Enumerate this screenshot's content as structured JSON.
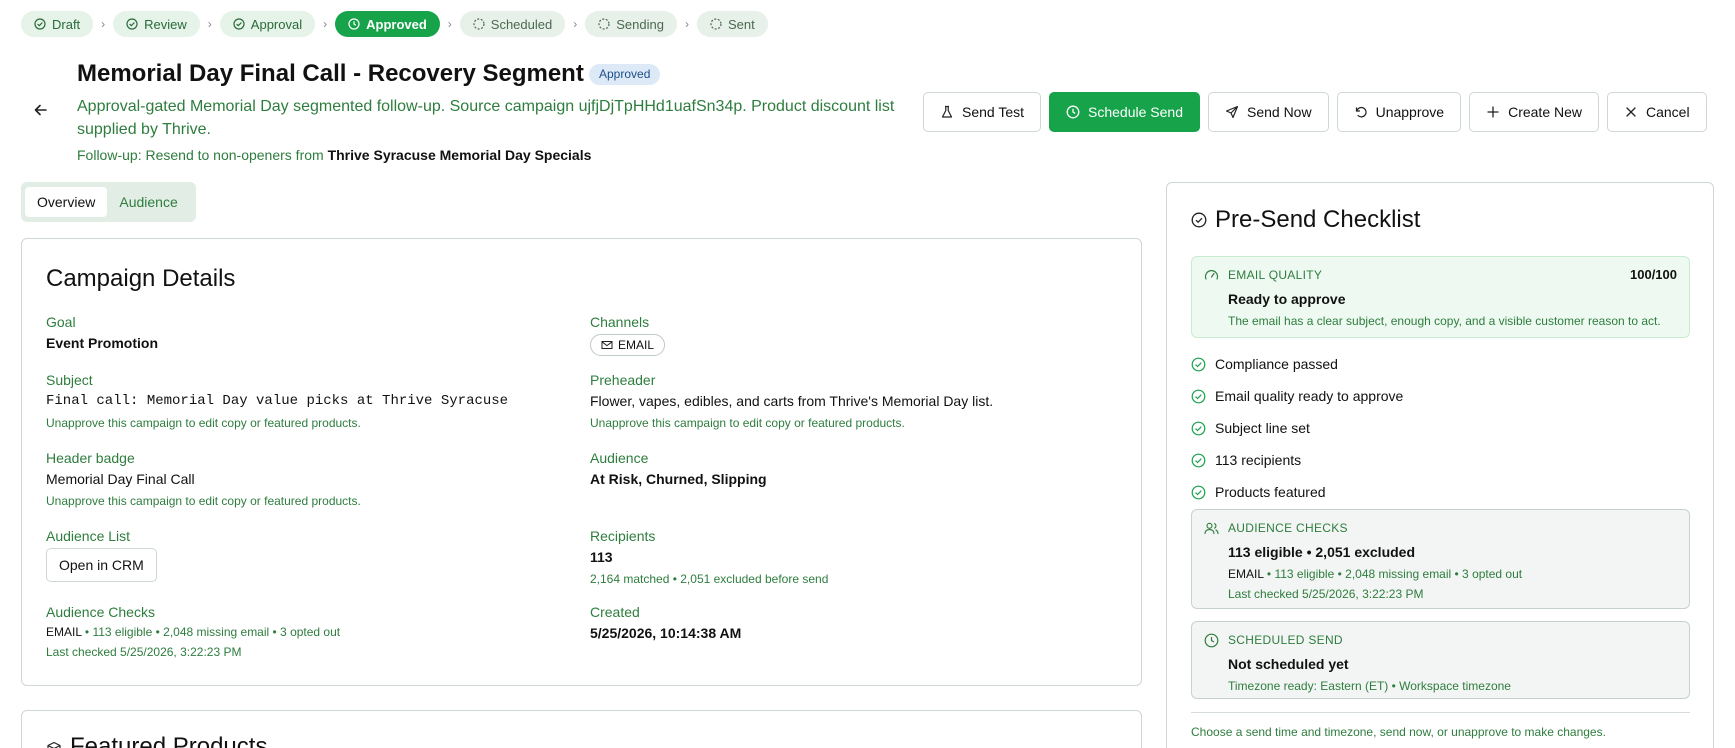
{
  "pipeline": [
    {
      "label": "Draft",
      "state": "done"
    },
    {
      "label": "Review",
      "state": "done"
    },
    {
      "label": "Approval",
      "state": "done"
    },
    {
      "label": "Approved",
      "state": "active"
    },
    {
      "label": "Scheduled",
      "state": "pending"
    },
    {
      "label": "Sending",
      "state": "pending"
    },
    {
      "label": "Sent",
      "state": "pending"
    }
  ],
  "header": {
    "title": "Memorial Day Final Call - Recovery Segment",
    "status_badge": "Approved",
    "description": "Approval-gated Memorial Day segmented follow-up. Source campaign ujfjDjTpHHd1uafSn34p. Product discount list supplied by Thrive.",
    "followup_prefix": "Follow-up: Resend to non-openers from",
    "followup_source": "Thrive Syracuse Memorial Day Specials"
  },
  "actions": {
    "send_test": "Send Test",
    "schedule_send": "Schedule Send",
    "send_now": "Send Now",
    "unapprove": "Unapprove",
    "create_new": "Create New",
    "cancel": "Cancel"
  },
  "tabs": {
    "overview": "Overview",
    "audience": "Audience"
  },
  "details": {
    "title": "Campaign Details",
    "goal_label": "Goal",
    "goal_value": "Event Promotion",
    "channels_label": "Channels",
    "channel_chip": "EMAIL",
    "subject_label": "Subject",
    "subject_value": "Final call: Memorial Day value picks at Thrive Syracuse",
    "subject_hint": "Unapprove this campaign to edit copy or featured products.",
    "preheader_label": "Preheader",
    "preheader_value": "Flower, vapes, edibles, and carts from Thrive's Memorial Day list.",
    "preheader_hint": "Unapprove this campaign to edit copy or featured products.",
    "badge_label": "Header badge",
    "badge_value": "Memorial Day Final Call",
    "badge_hint": "Unapprove this campaign to edit copy or featured products.",
    "audience_label": "Audience",
    "audience_value": "At Risk, Churned, Slipping",
    "list_label": "Audience List",
    "list_button": "Open in CRM",
    "recipients_label": "Recipients",
    "recipients_value": "113",
    "recipients_hint": "2,164 matched • 2,051 excluded before send",
    "checks_label": "Audience Checks",
    "checks_channel": "EMAIL",
    "checks_summary": " • 113 eligible • 2,048 missing email • 3 opted out",
    "checks_last": "Last checked 5/25/2026, 3:22:23 PM",
    "created_label": "Created",
    "created_value": "5/25/2026, 10:14:38 AM"
  },
  "featured": {
    "title": "Featured Products"
  },
  "checklist": {
    "title": "Pre-Send Checklist",
    "quality_head": "EMAIL QUALITY",
    "quality_score": "100/100",
    "quality_title": "Ready to approve",
    "quality_sub": "The email has a clear subject, enough copy, and a visible customer reason to act.",
    "items": [
      "Compliance passed",
      "Email quality ready to approve",
      "Subject line set",
      "113 recipients",
      "Products featured"
    ],
    "audience_head": "AUDIENCE CHECKS",
    "audience_title": "113 eligible • 2,051 excluded",
    "audience_channel": "EMAIL",
    "audience_sub": " • 113 eligible • 2,048 missing email • 3 opted out",
    "audience_last": "Last checked 5/25/2026, 3:22:23 PM",
    "sched_head": "SCHEDULED SEND",
    "sched_title": "Not scheduled yet",
    "sched_sub": "Timezone ready: Eastern (ET) • Workspace timezone",
    "footer": "Choose a send time and timezone, send now, or unapprove to make changes."
  },
  "colors": {
    "accent": "#16a34a",
    "accent_text": "#2e7d3e",
    "badge_bg": "#dde9f7"
  }
}
